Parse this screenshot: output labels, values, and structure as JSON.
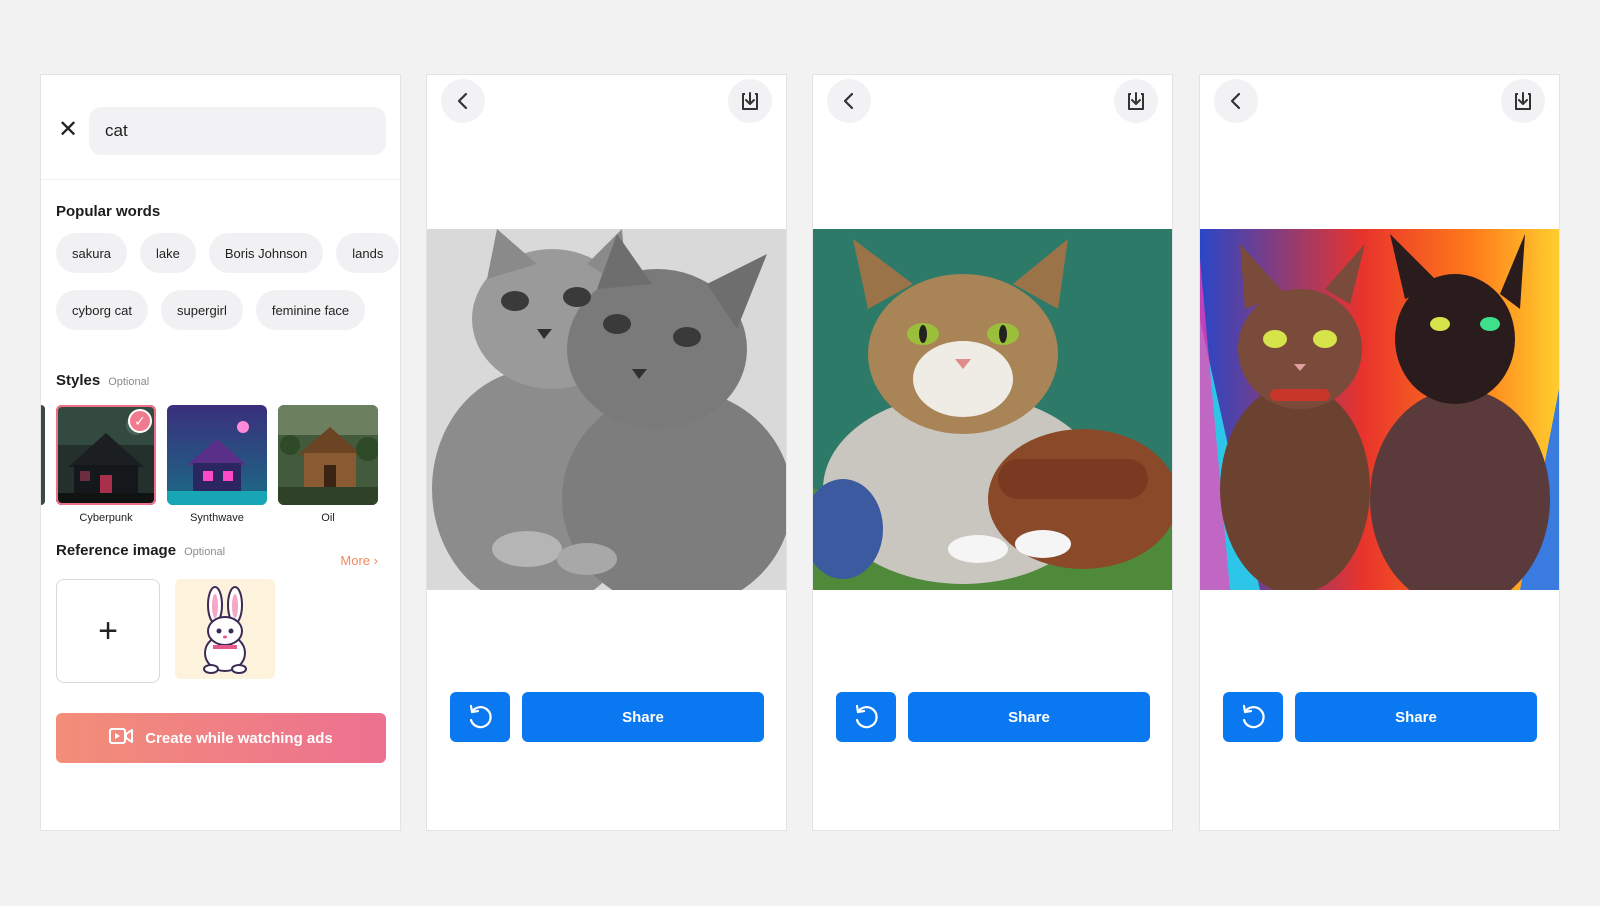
{
  "prompt_screen": {
    "search": {
      "value": "cat"
    },
    "popular_words": {
      "title": "Popular words",
      "row1": [
        "sakura",
        "lake",
        "Boris Johnson",
        "lands"
      ],
      "row2": [
        "cyborg cat",
        "supergirl",
        "feminine face"
      ]
    },
    "styles": {
      "title": "Styles",
      "optional": "Optional",
      "items": [
        {
          "label": "Cyberpunk",
          "selected": true
        },
        {
          "label": "Synthwave",
          "selected": false
        },
        {
          "label": "Oil",
          "selected": false
        }
      ]
    },
    "reference": {
      "title": "Reference image",
      "optional": "Optional",
      "more_label": "More",
      "add_symbol": "+"
    },
    "create_button": {
      "label": "Create while watching ads"
    },
    "colors": {
      "accent_orange": "#f08a62",
      "gradient_start": "#f38e79",
      "gradient_end": "#ec7190"
    }
  },
  "result_screens": [
    {
      "share_label": "Share",
      "art": "pencil-sketch-cats"
    },
    {
      "share_label": "Share",
      "art": "oil-painting-cat"
    },
    {
      "share_label": "Share",
      "art": "synthwave-cats"
    }
  ],
  "colors": {
    "primary_blue": "#0a78f0"
  }
}
